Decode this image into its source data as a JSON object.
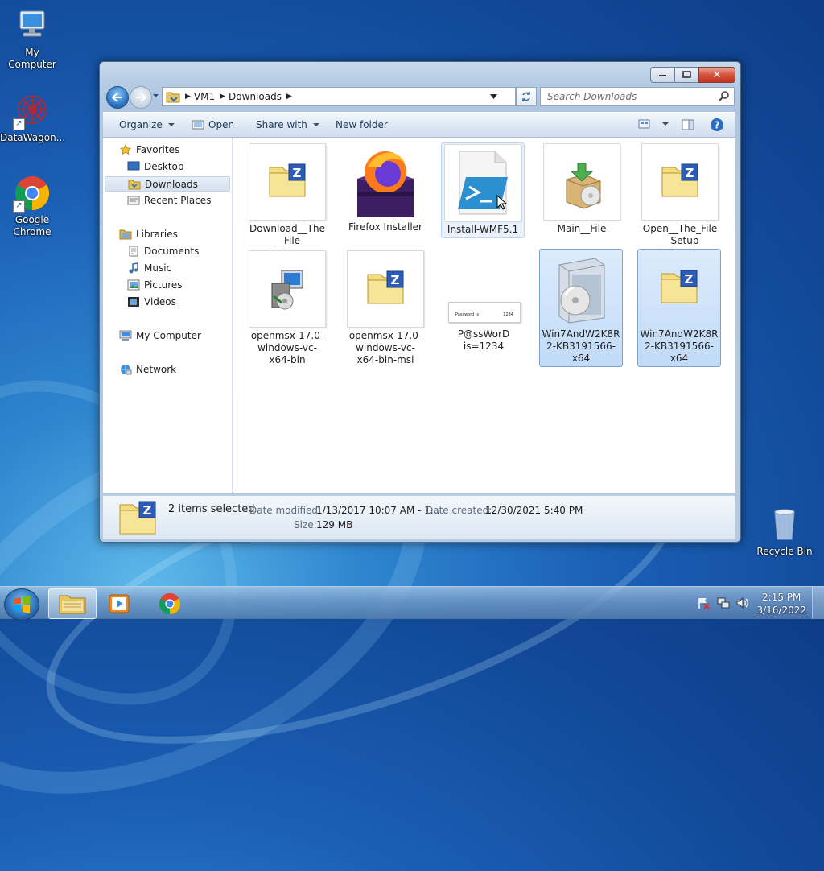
{
  "desktop": {
    "icons": [
      {
        "label": "My Computer"
      },
      {
        "label": "DataWagon..."
      },
      {
        "label": "Google Chrome"
      },
      {
        "label": "Recycle Bin"
      }
    ]
  },
  "window": {
    "address": {
      "crumbs": [
        "VM1",
        "Downloads"
      ]
    },
    "search_placeholder": "Search Downloads",
    "toolbar": {
      "organize": "Organize",
      "open": "Open",
      "share_with": "Share with",
      "new_folder": "New folder"
    },
    "nav": {
      "favorites": "Favorites",
      "desktop": "Desktop",
      "downloads": "Downloads",
      "recent_places": "Recent Places",
      "libraries": "Libraries",
      "documents": "Documents",
      "music": "Music",
      "pictures": "Pictures",
      "videos": "Videos",
      "my_computer": "My Computer",
      "network": "Network"
    },
    "files": [
      {
        "name": "Download__The__File",
        "kind": "zip"
      },
      {
        "name": "Firefox Installer",
        "kind": "firefox"
      },
      {
        "name": "Install-WMF5.1",
        "kind": "powershell"
      },
      {
        "name": "Main__File",
        "kind": "installer"
      },
      {
        "name": "Open__The_File__Setup",
        "kind": "zip"
      },
      {
        "name": "openmsx-17.0-windows-vc-x64-bin",
        "kind": "setup"
      },
      {
        "name": "openmsx-17.0-windows-vc-x64-bin-msi",
        "kind": "zip"
      },
      {
        "name": "P@ssWorD is=1234",
        "kind": "image",
        "thumb_left": "Password Is",
        "thumb_right": "1234"
      },
      {
        "name": "Win7AndW2K8R2-KB3191566-x64",
        "kind": "box"
      },
      {
        "name": "Win7AndW2K8R2-KB3191566-x64",
        "kind": "zip"
      }
    ],
    "details": {
      "selected": "2 items selected",
      "date_modified_label": "Date modified:",
      "date_modified": "1/13/2017 10:07 AM - 1...",
      "date_created_label": "Date created:",
      "date_created": "12/30/2021 5:40 PM",
      "size_label": "Size:",
      "size": "129 MB"
    }
  },
  "taskbar": {
    "time": "2:15 PM",
    "date": "3/16/2022"
  },
  "colors": {
    "accent": "#1b5fb5",
    "selection": "#c1dbf8"
  }
}
